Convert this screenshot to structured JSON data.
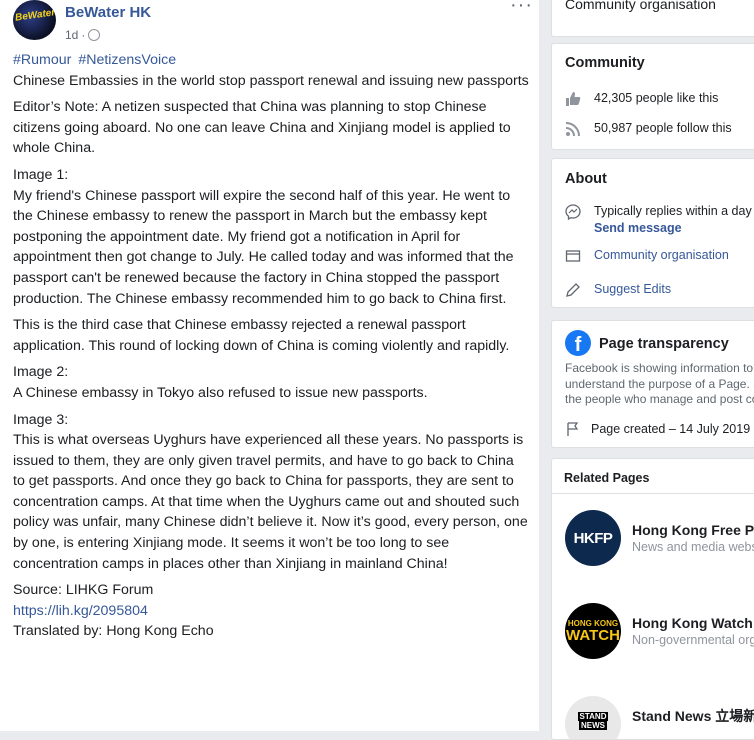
{
  "post": {
    "page_name": "BeWater HK",
    "avatar_text": "BeWater",
    "time": "1d",
    "hashtags": [
      "#Rumour",
      "#NetizensVoice"
    ],
    "headline": "Chinese Embassies in the world stop passport renewal and issuing new passports",
    "editor_note": "Editor’s Note: A netizen suspected that China was planning to stop Chinese citizens going aboard. No one can leave China and Xinjiang model is applied to whole China.",
    "image1_label": "Image 1:",
    "image1_text": "My friend's Chinese passport will expire the second half of this year. He went to the Chinese embassy to renew the passport in March but the embassy kept postponing the appointment date. My friend got a notification in April for appointment then got change to July. He called today and was informed that the passport can't be renewed because the factory in China stopped the passport production. The Chinese embassy recommended him to go back to China first.",
    "third_case": "This is the third case that Chinese embassy rejected a renewal passport application. This round of locking down of China is coming violently and rapidly.",
    "image2_label": "Image 2:",
    "image2_text": "A Chinese embassy in Tokyo also refused to issue new passports.",
    "image3_label": "Image 3:",
    "image3_text": "This is what overseas Uyghurs have experienced all these years. No passports is issued to them, they are only given travel permits, and have to go back to China to get passports. And once they go back to China for passports, they are sent to concentration camps. At that time when the Uyghurs came out and shouted such policy was unfair, many Chinese didn’t believe it. Now it’s good, every person, one by one, is entering Xinjiang mode. It seems it won’t be too long to see concentration camps in places other than Xinjiang in mainland China!",
    "source": "Source: LIHKG Forum",
    "source_link": "https://lih.kg/2095804",
    "translated_by": "Translated by: Hong Kong Echo"
  },
  "sidebar": {
    "top_category": "Community organisation",
    "community": {
      "title": "Community",
      "likes": "42,305 people like this",
      "follows": "50,987 people follow this"
    },
    "about": {
      "title": "About",
      "replies": "Typically replies within a day",
      "send_message": "Send message",
      "category": "Community organisation",
      "suggest_edits": "Suggest Edits"
    },
    "transparency": {
      "title": "Page transparency",
      "desc_line1": "Facebook is showing information to help you",
      "desc_line2": "understand the purpose of a Page. See actions taken by",
      "desc_line3": "the people who manage and post content.",
      "created": "Page created – 14 July 2019"
    },
    "related": {
      "title": "Related Pages",
      "items": [
        {
          "name": "Hong Kong Free Press",
          "sub": "News and media website",
          "logo": "HKFP"
        },
        {
          "name": "Hong Kong Watch",
          "sub": "Non-governmental organisation",
          "logo_top": "HONG KONG",
          "logo_bottom": "WATCH"
        },
        {
          "name": "Stand News 立場新聞",
          "sub": "",
          "logo_top": "STAND",
          "logo_bottom": "NEWS"
        }
      ]
    }
  },
  "colors": {
    "link": "#365899",
    "page_bg": "#e9ebee",
    "hkfp": "#0d2a4e",
    "hkwatch_yellow": "#f5c518",
    "facebook_blue": "#1877f2"
  }
}
